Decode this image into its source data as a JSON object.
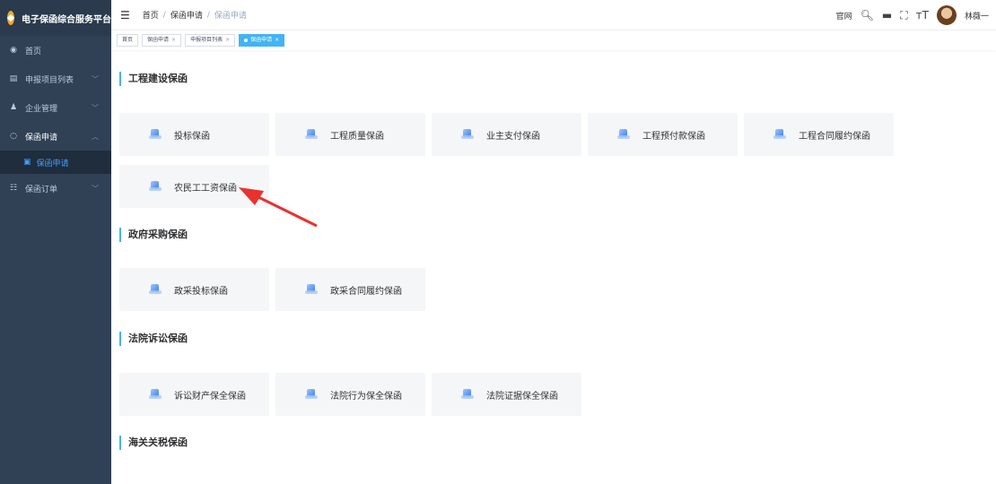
{
  "brand": {
    "title": "电子保函综合服务平台"
  },
  "sidebar": {
    "items": [
      {
        "label": "首页",
        "icon": "dashboard-icon"
      },
      {
        "label": "申报项目列表",
        "icon": "list-icon"
      },
      {
        "label": "企业管理",
        "icon": "user-icon"
      },
      {
        "label": "保函申请",
        "icon": "shield-icon"
      },
      {
        "label": "保函申请",
        "icon": "form-icon"
      },
      {
        "label": "保函订单",
        "icon": "order-icon"
      }
    ]
  },
  "header": {
    "breadcrumb": [
      "首页",
      "保函申请",
      "保函申请"
    ],
    "official_site": "官网",
    "username": "林薇一"
  },
  "tags": [
    {
      "label": "首页"
    },
    {
      "label": "保函申请"
    },
    {
      "label": "申报项目列表"
    },
    {
      "label": "保函申请"
    }
  ],
  "sections": [
    {
      "title": "工程建设保函",
      "cards": [
        "投标保函",
        "工程质量保函",
        "业主支付保函",
        "工程预付款保函",
        "工程合同履约保函",
        "农民工工资保函"
      ]
    },
    {
      "title": "政府采购保函",
      "cards": [
        "政采投标保函",
        "政采合同履约保函"
      ]
    },
    {
      "title": "法院诉讼保函",
      "cards": [
        "诉讼财产保全保函",
        "法院行为保全保函",
        "法院证据保全保函"
      ]
    },
    {
      "title": "海关关税保函",
      "cards": []
    }
  ],
  "colors": {
    "sidebar_bg": "#304156",
    "accent": "#42b4f3",
    "card_bg": "#f5f6f8",
    "arrow": "#e8322f"
  }
}
